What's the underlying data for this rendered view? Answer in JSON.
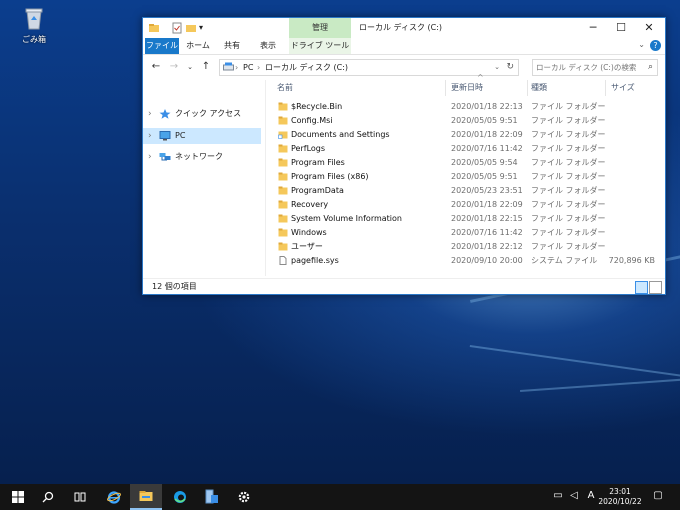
{
  "desktop": {
    "recycle_bin_label": "ごみ箱"
  },
  "window": {
    "title": "ローカル ディスク (C:)",
    "manage_tab": "管理",
    "ribbon_tabs": [
      "ファイル",
      "ホーム",
      "共有",
      "表示"
    ],
    "drive_tools_tab": "ドライブ ツール",
    "help_label": "?"
  },
  "address": {
    "segments": [
      "PC",
      "ローカル ディスク (C:)"
    ]
  },
  "search": {
    "placeholder": "ローカル ディスク (C:)の検索"
  },
  "nav": {
    "items": [
      {
        "label": "クイック アクセス",
        "icon": "star-icon"
      },
      {
        "label": "PC",
        "icon": "pc-icon",
        "selected": true
      },
      {
        "label": "ネットワーク",
        "icon": "network-icon"
      }
    ]
  },
  "columns": {
    "name": "名前",
    "date": "更新日時",
    "type": "種類",
    "size": "サイズ"
  },
  "files": [
    {
      "name": "$Recycle.Bin",
      "date": "2020/01/18 22:13",
      "type": "ファイル フォルダー",
      "size": "",
      "icon": "folder-icon"
    },
    {
      "name": "Config.Msi",
      "date": "2020/05/05 9:51",
      "type": "ファイル フォルダー",
      "size": "",
      "icon": "folder-icon"
    },
    {
      "name": "Documents and Settings",
      "date": "2020/01/18 22:09",
      "type": "ファイル フォルダー",
      "size": "",
      "icon": "folder-shortcut-icon"
    },
    {
      "name": "PerfLogs",
      "date": "2020/07/16 11:42",
      "type": "ファイル フォルダー",
      "size": "",
      "icon": "folder-icon"
    },
    {
      "name": "Program Files",
      "date": "2020/05/05 9:54",
      "type": "ファイル フォルダー",
      "size": "",
      "icon": "folder-icon"
    },
    {
      "name": "Program Files (x86)",
      "date": "2020/05/05 9:51",
      "type": "ファイル フォルダー",
      "size": "",
      "icon": "folder-icon"
    },
    {
      "name": "ProgramData",
      "date": "2020/05/23 23:51",
      "type": "ファイル フォルダー",
      "size": "",
      "icon": "folder-icon"
    },
    {
      "name": "Recovery",
      "date": "2020/01/18 22:09",
      "type": "ファイル フォルダー",
      "size": "",
      "icon": "folder-icon"
    },
    {
      "name": "System Volume Information",
      "date": "2020/01/18 22:15",
      "type": "ファイル フォルダー",
      "size": "",
      "icon": "folder-icon"
    },
    {
      "name": "Windows",
      "date": "2020/07/16 11:42",
      "type": "ファイル フォルダー",
      "size": "",
      "icon": "folder-icon"
    },
    {
      "name": "ユーザー",
      "date": "2020/01/18 22:12",
      "type": "ファイル フォルダー",
      "size": "",
      "icon": "folder-icon"
    },
    {
      "name": "pagefile.sys",
      "date": "2020/09/10 20:00",
      "type": "システム ファイル",
      "size": "720,896 KB",
      "icon": "file-icon"
    }
  ],
  "status": {
    "count": "12 個の項目"
  },
  "taskbar": {
    "apps": [
      "start-icon",
      "search-icon",
      "task-view-icon",
      "ie-icon",
      "file-explorer-icon",
      "edge-icon",
      "server-manager-icon",
      "settings-icon"
    ],
    "ime": "A",
    "time": "23:01",
    "date": "2020/10/22"
  },
  "colors": {
    "accent": "#1979ca",
    "selection": "#cce8ff",
    "manage_tab": "#c9eac4",
    "folder": "#f5c85b"
  }
}
